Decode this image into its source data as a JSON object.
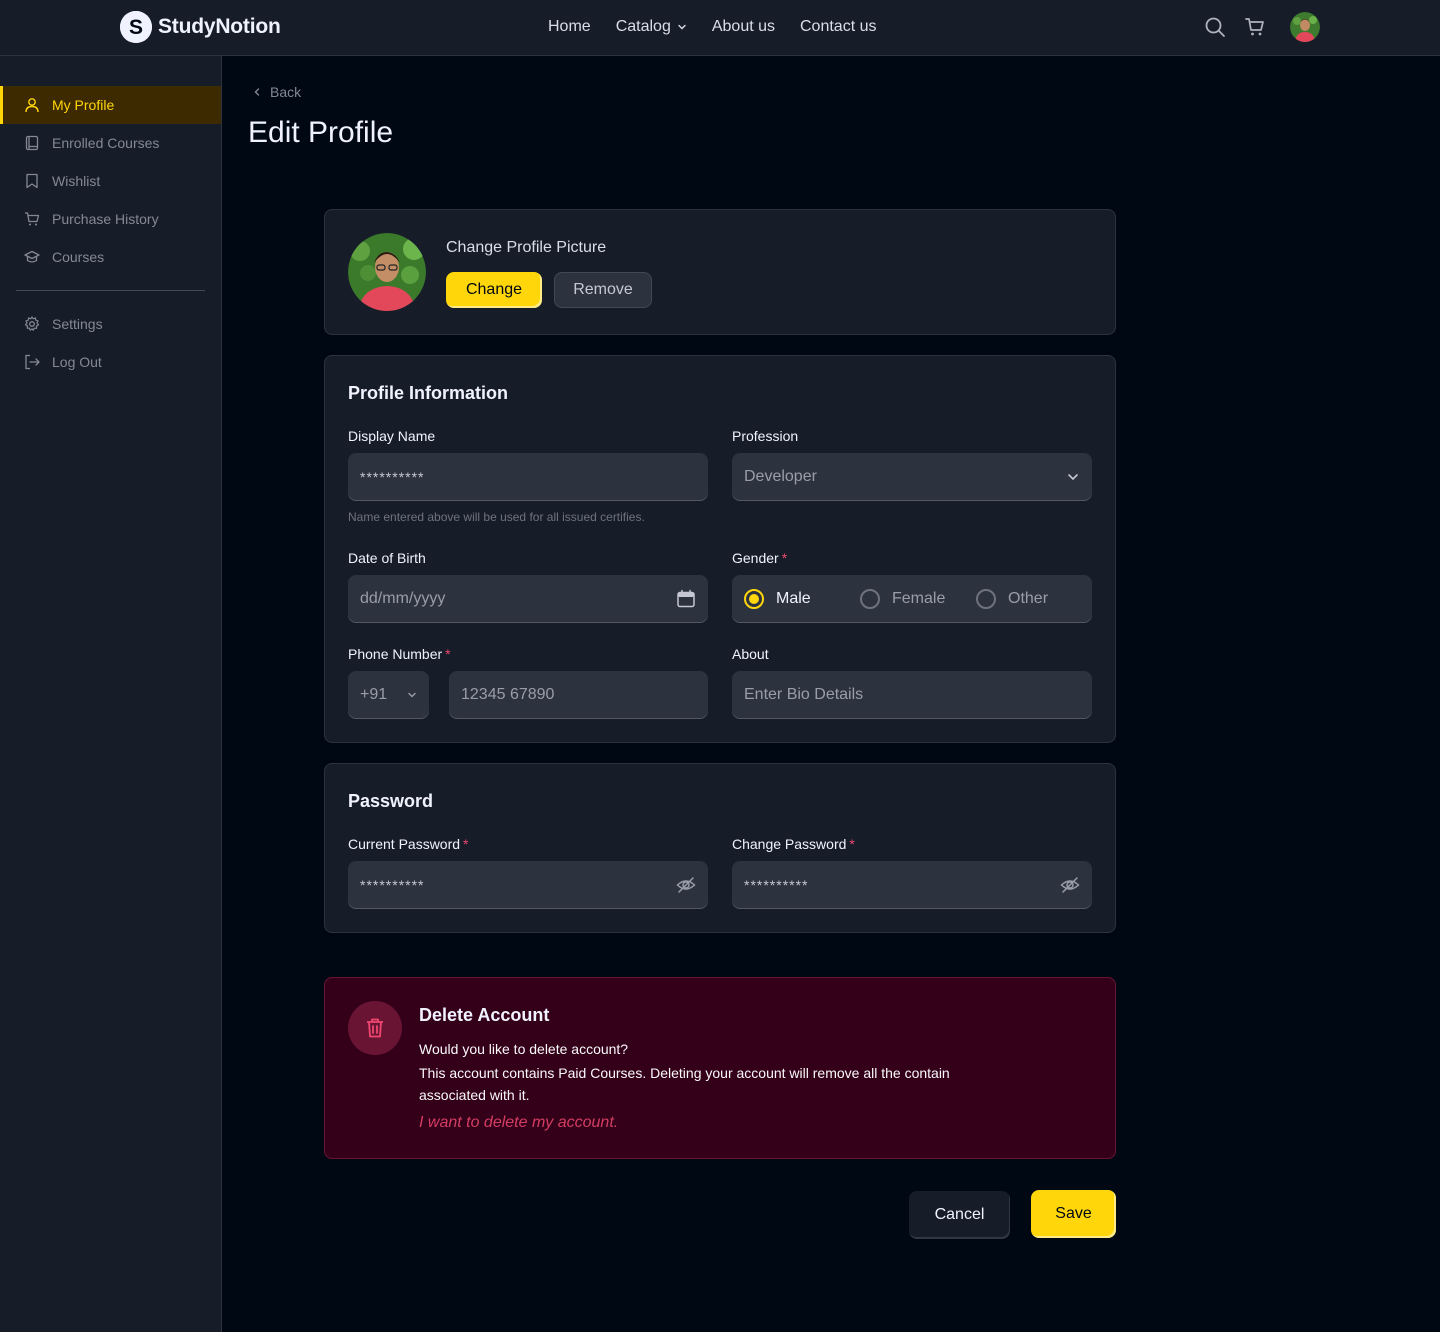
{
  "brand": {
    "name": "StudyNotion",
    "logo_letter": "S"
  },
  "nav": {
    "links": [
      {
        "label": "Home"
      },
      {
        "label": "Catalog"
      },
      {
        "label": "About us"
      },
      {
        "label": "Contact us"
      }
    ],
    "icons": [
      "search-icon",
      "cart-icon",
      "user-avatar"
    ]
  },
  "sidebar": {
    "items": [
      {
        "label": "My Profile",
        "icon": "user-icon",
        "active": true
      },
      {
        "label": "Enrolled Courses",
        "icon": "book-icon"
      },
      {
        "label": "Wishlist",
        "icon": "bookmark-icon"
      },
      {
        "label": "Purchase History",
        "icon": "cart-icon"
      },
      {
        "label": "Courses",
        "icon": "graduation-cap-icon"
      }
    ],
    "bottom_items": [
      {
        "label": "Settings",
        "icon": "gear-icon"
      },
      {
        "label": "Log Out",
        "icon": "logout-icon"
      }
    ]
  },
  "page": {
    "back_label": "Back",
    "title": "Edit Profile"
  },
  "profile_picture": {
    "title": "Change Profile Picture",
    "change_label": "Change",
    "remove_label": "Remove"
  },
  "profile_info": {
    "title": "Profile Information",
    "display_name": {
      "label": "Display Name",
      "value": "**********",
      "hint": "Name entered above will be used for all issued certifies."
    },
    "profession": {
      "label": "Profession",
      "value": "Developer"
    },
    "dob": {
      "label": "Date of Birth",
      "placeholder": "dd/mm/yyyy"
    },
    "gender": {
      "label": "Gender",
      "options": [
        "Male",
        "Female",
        "Other"
      ],
      "selected": "Male"
    },
    "phone": {
      "label": "Phone Number",
      "country_code": "+91",
      "value": "12345 67890"
    },
    "about": {
      "label": "About",
      "placeholder": "Enter Bio Details"
    }
  },
  "password": {
    "title": "Password",
    "current": {
      "label": "Current Password",
      "value": "**********"
    },
    "change": {
      "label": "Change Password",
      "value": "**********"
    }
  },
  "delete_account": {
    "title": "Delete Account",
    "line1": "Would you like to delete account?",
    "line2": "This account contains Paid Courses. Deleting your account will remove all the contain associated with it.",
    "link": "I want to delete my account."
  },
  "actions": {
    "cancel_label": "Cancel",
    "save_label": "Save"
  },
  "colors": {
    "accent": "#FFD60A",
    "bg": "#000814",
    "panel": "#161D29",
    "danger": "#EF476F"
  }
}
